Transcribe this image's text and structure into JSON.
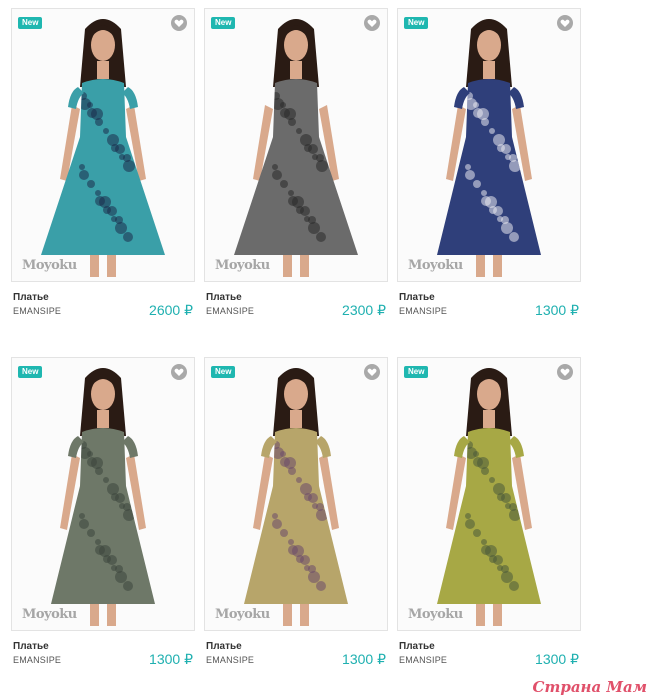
{
  "products": [
    {
      "badge": "New",
      "name": "Платье",
      "brand": "EMANSIPE",
      "price": "2600 ₽",
      "watermark": "Moyoku",
      "dress": "#3a9fa8",
      "dress2": "#1c2b4a",
      "skin": "#d9a98c",
      "hair": "#2a1b14"
    },
    {
      "badge": "New",
      "name": "Платье",
      "brand": "EMANSIPE",
      "price": "2300 ₽",
      "watermark": "Moyoku",
      "dress": "#6b6b6b",
      "dress2": "#2a2a2a",
      "skin": "#d9a98c",
      "hair": "#2a1b14"
    },
    {
      "badge": "New",
      "name": "Платье",
      "brand": "EMANSIPE",
      "price": "1300 ₽",
      "watermark": "Moyoku",
      "dress": "#2f3f7a",
      "dress2": "#e8e8ef",
      "skin": "#d9a98c",
      "hair": "#2a1b14"
    },
    {
      "badge": "New",
      "name": "Платье",
      "brand": "EMANSIPE",
      "price": "1300 ₽",
      "watermark": "Moyoku",
      "dress": "#6e7868",
      "dress2": "#3d453c",
      "skin": "#d9a98c",
      "hair": "#2a1b14"
    },
    {
      "badge": "New",
      "name": "Платье",
      "brand": "EMANSIPE",
      "price": "1300 ₽",
      "watermark": "Moyoku",
      "dress": "#b7a56a",
      "dress2": "#6b4a6a",
      "skin": "#d9a98c",
      "hair": "#2a1b14"
    },
    {
      "badge": "New",
      "name": "Платье",
      "brand": "EMANSIPE",
      "price": "1300 ₽",
      "watermark": "Moyoku",
      "dress": "#a7a845",
      "dress2": "#4a5a3a",
      "skin": "#d9a98c",
      "hair": "#2a1b14"
    }
  ],
  "site_stamp": "Страна Мам"
}
